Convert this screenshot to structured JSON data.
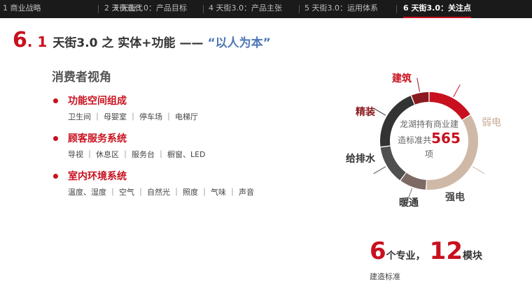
{
  "nav": {
    "tabs": [
      {
        "label": "1 商业战略"
      },
      {
        "label": "2 天街迭代"
      },
      {
        "label": "3 天街3.0：产品目标"
      },
      {
        "label": "4 天街3.0：产品主张"
      },
      {
        "label": "5 天街3.0：运用体系"
      },
      {
        "label": "6 天街3.0：关注点"
      }
    ]
  },
  "title": {
    "number": "6",
    "sub_number": ". 1",
    "main": "天街3.0 之 实体+功能 ——",
    "quote": "“以人为本”"
  },
  "content": {
    "heading": "消费者视角",
    "groups": [
      {
        "title": "功能空间组成",
        "items": "卫生间 ｜ 母婴室 ｜ 停车场 ｜  电梯厅"
      },
      {
        "title": "顾客服务系统",
        "items": "导视 ｜ 休息区 ｜ 服务台 ｜ 橱窗、LED"
      },
      {
        "title": "室内环境系统",
        "items": "温度、湿度 ｜ 空气 ｜ 自然光 ｜ 照度 ｜ 气味  ｜ 声音"
      }
    ]
  },
  "chart_data": {
    "type": "pie",
    "center_text_line1": "龙湖持有商业建",
    "center_text_line2": "造标准共",
    "center_value": "565",
    "center_text_line3": "项",
    "slices": [
      {
        "label": "建筑",
        "value": 16,
        "color": "#c8101e"
      },
      {
        "label": "弱电",
        "value": 35,
        "color": "#cfb8a6"
      },
      {
        "label": "强电",
        "value": 9,
        "color": "#7d6a65"
      },
      {
        "label": "暖通",
        "value": 13,
        "color": "#505050"
      },
      {
        "label": "给排水",
        "value": 21,
        "color": "#333333"
      },
      {
        "label": "精装",
        "value": 6,
        "color": "#8a1a1f"
      }
    ]
  },
  "stats": {
    "count1": "6",
    "label1": "个专业，",
    "count2": "12",
    "label2": "模块",
    "caption": "建造标准"
  }
}
